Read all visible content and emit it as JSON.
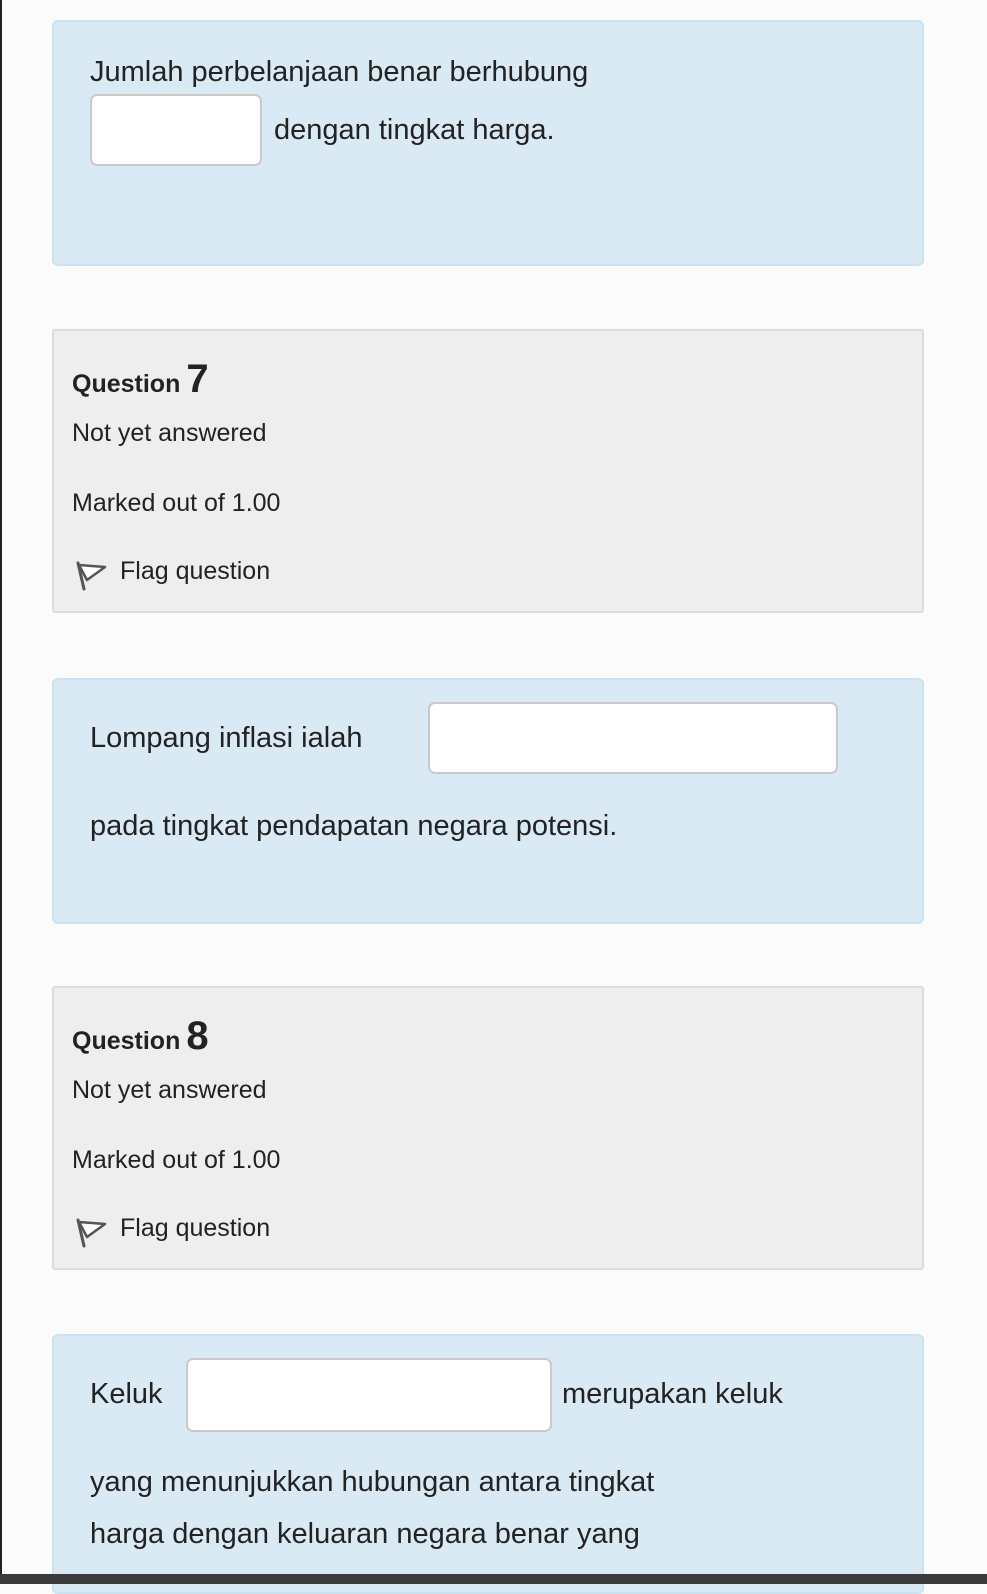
{
  "q6_text": {
    "line1": "Jumlah perbelanjaan benar berhubung",
    "line2": "dengan tingkat harga.",
    "answer": ""
  },
  "q7_info": {
    "question_word": "Question",
    "question_number": "7",
    "state": "Not yet answered",
    "grade": "Marked out of 1.00",
    "flag_label": "Flag question"
  },
  "q7_text": {
    "line1": "Lompang inflasi ialah",
    "line2": "pada tingkat pendapatan negara potensi.",
    "answer": ""
  },
  "q8_info": {
    "question_word": "Question",
    "question_number": "8",
    "state": "Not yet answered",
    "grade": "Marked out of 1.00",
    "flag_label": "Flag question"
  },
  "q8_text": {
    "line1_before": "Keluk",
    "line1_after": "merupakan keluk",
    "line2": "yang menunjukkan hubungan antara tingkat",
    "line3": "harga dengan keluaran negara benar yang",
    "answer": ""
  },
  "colors": {
    "question_text_bg": "#d9eaf4",
    "info_bg": "#eeeeee"
  }
}
